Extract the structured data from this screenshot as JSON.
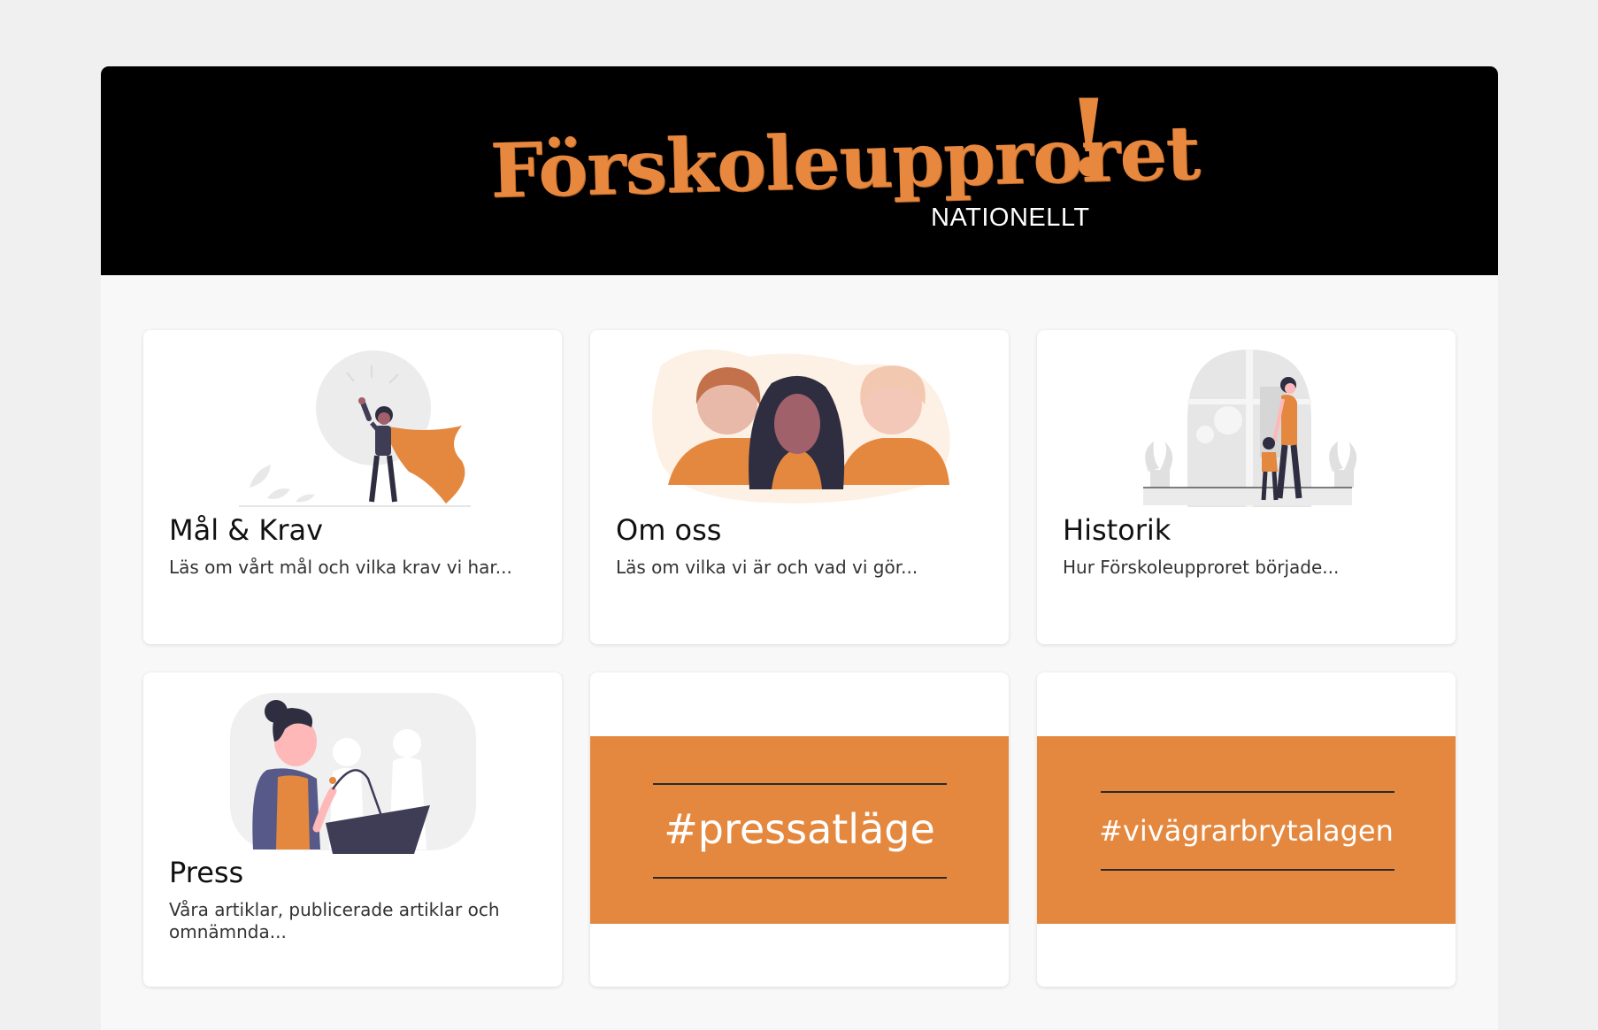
{
  "header": {
    "logo_text": "Förskoleupproret",
    "logo_exclaim": "!",
    "logo_subtitle": "NATIONELLT"
  },
  "cards": [
    {
      "title": "Mål & Krav",
      "description": "Läs om vårt mål och vilka krav vi har..."
    },
    {
      "title": "Om oss",
      "description": "Läs om vilka vi är och vad vi gör..."
    },
    {
      "title": "Historik",
      "description": "Hur Förskoleupproret började..."
    },
    {
      "title": "Press",
      "description": "Våra artiklar, publicerade artiklar och omnämnda..."
    },
    {
      "tag": "#pressatläge"
    },
    {
      "tag": "#vivägrarbrytalagen"
    }
  ],
  "colors": {
    "accent": "#e5883f",
    "banner": "#000000",
    "page_background": "#f0f0f0",
    "dark_figure": "#3f3d56"
  }
}
